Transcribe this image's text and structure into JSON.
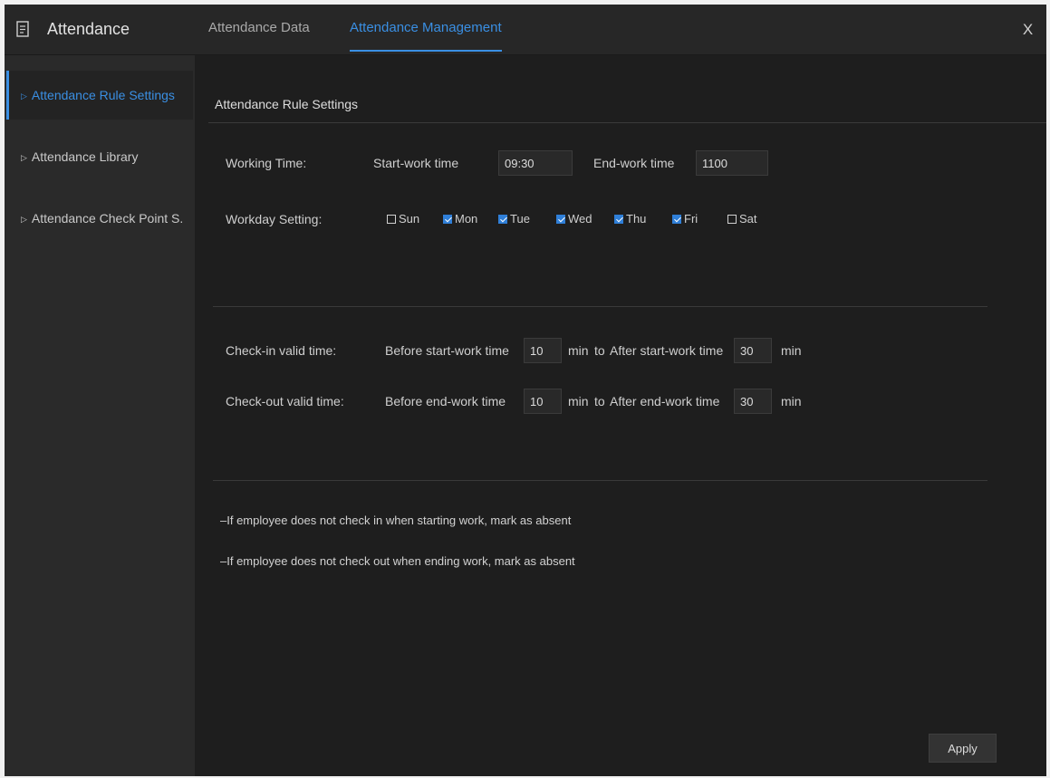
{
  "window": {
    "title": "Attendance",
    "title_icon": "document-icon",
    "close_label": "X",
    "tabs": [
      {
        "label": "Attendance Data",
        "active": false
      },
      {
        "label": "Attendance Management",
        "active": true
      }
    ]
  },
  "sidebar": {
    "items": [
      {
        "label": "Attendance Rule Settings",
        "icon": "triangle-right-icon",
        "active": true
      },
      {
        "label": "Attendance Library",
        "icon": "triangle-right-icon",
        "active": false
      },
      {
        "label": "Attendance Check Point S.",
        "icon": "triangle-right-icon",
        "active": false
      }
    ]
  },
  "main": {
    "section_title": "Attendance Rule Settings",
    "working_time": {
      "label": "Working Time:",
      "start_label": "Start-work time",
      "start_value": "09:30",
      "end_label": "End-work time",
      "end_value": "1100"
    },
    "workday": {
      "label": "Workday Setting:",
      "days": [
        {
          "label": "Sun",
          "checked": false
        },
        {
          "label": "Mon",
          "checked": true
        },
        {
          "label": "Tue",
          "checked": true
        },
        {
          "label": "Wed",
          "checked": true
        },
        {
          "label": "Thu",
          "checked": true
        },
        {
          "label": "Fri",
          "checked": true
        },
        {
          "label": "Sat",
          "checked": false
        }
      ]
    },
    "check_in": {
      "label": "Check-in valid time:",
      "before_label": "Before start-work time",
      "before_value": "10",
      "before_unit": "min",
      "to_label": "to",
      "after_label": "After start-work time",
      "after_value": "30",
      "after_unit": "min"
    },
    "check_out": {
      "label": "Check-out valid time:",
      "before_label": "Before end-work time",
      "before_value": "10",
      "before_unit": "min",
      "to_label": "to",
      "after_label": "After end-work time",
      "after_value": "30",
      "after_unit": "min"
    },
    "notes": [
      "–If employee does not check in when starting work, mark as absent",
      "–If employee does not check out when ending work, mark as absent"
    ],
    "apply_label": "Apply"
  },
  "colors": {
    "accent": "#3a8fe3",
    "background": "#1e1e1e",
    "panel": "#2a2a2a",
    "topbar": "#272727",
    "text": "#cfcfcf",
    "checkbox_checked": "#2f7fd8"
  }
}
